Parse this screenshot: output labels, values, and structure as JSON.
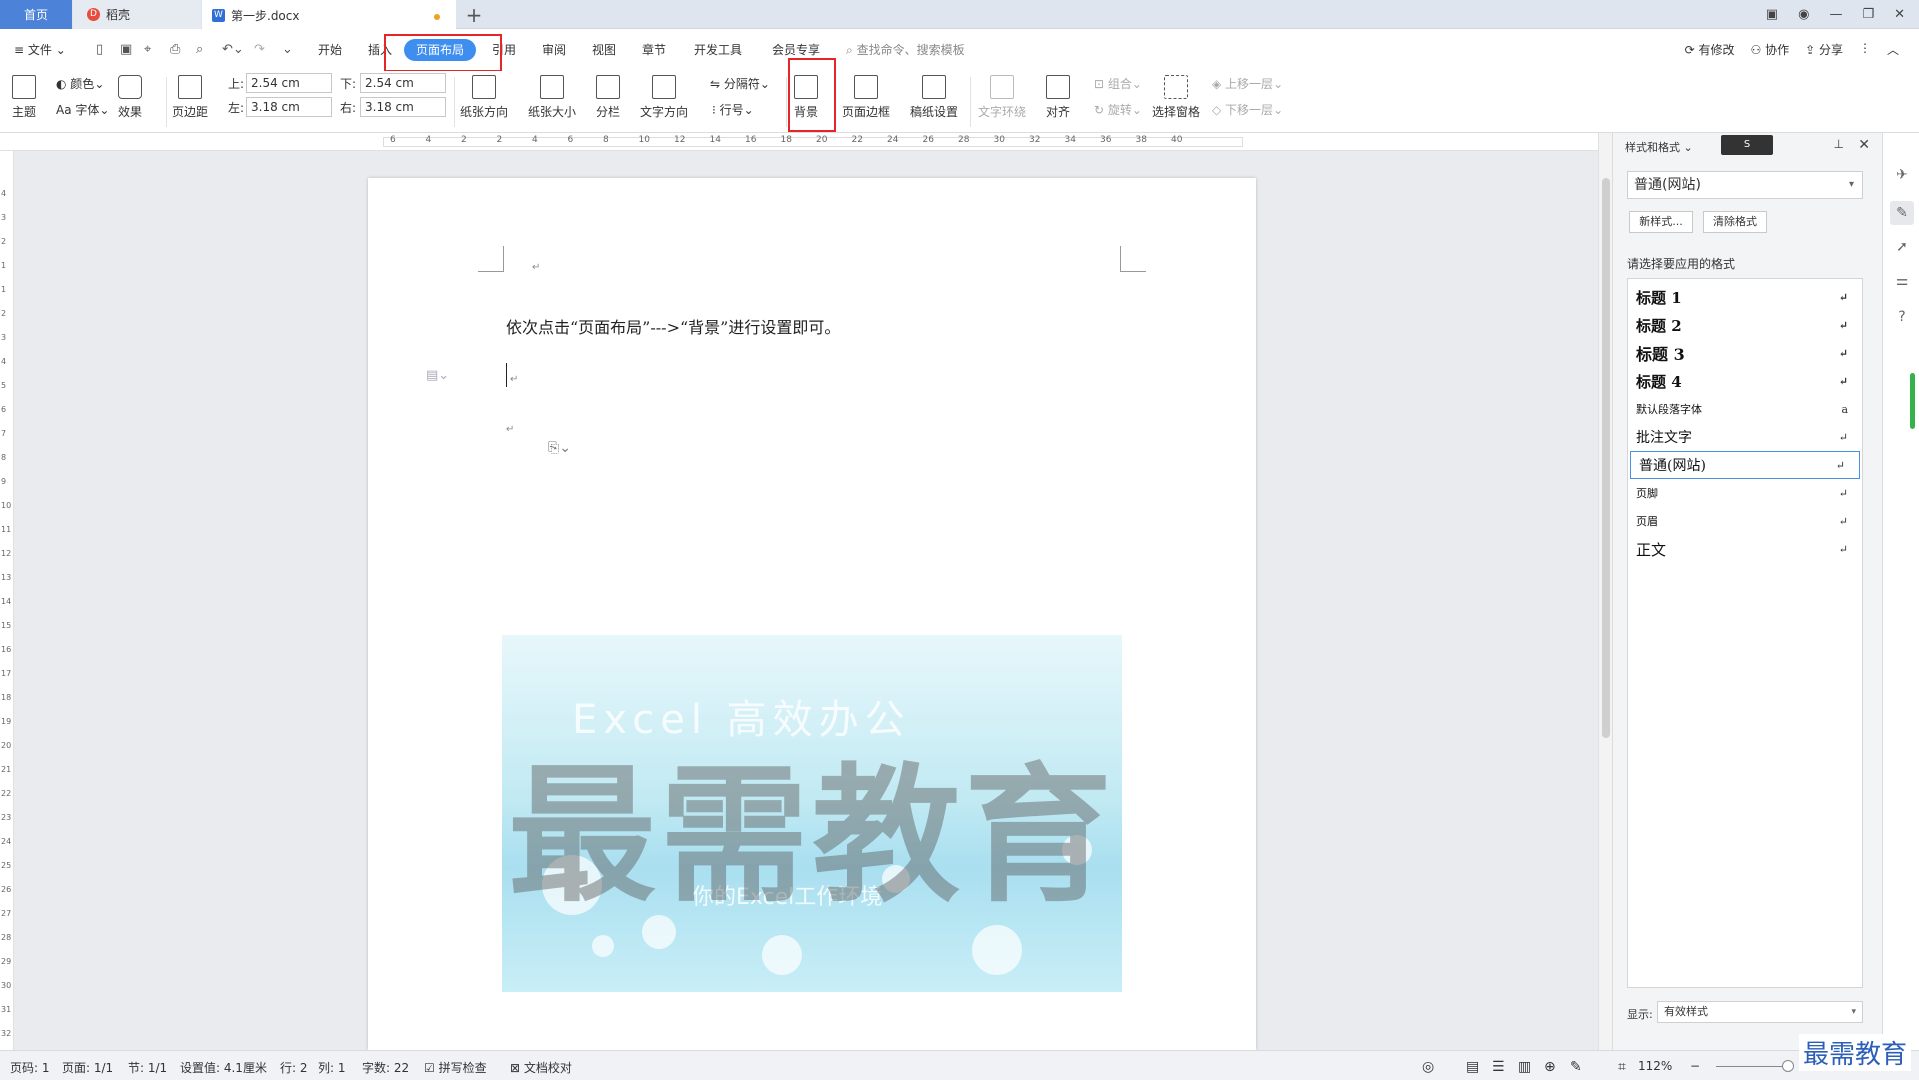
{
  "tabs": {
    "home": "首页",
    "daoke": "稻壳",
    "doc": "第一步.docx",
    "add": "+"
  },
  "menu": {
    "file": "文件",
    "items": [
      "开始",
      "插入",
      "页面布局",
      "引用",
      "审阅",
      "视图",
      "章节",
      "开发工具",
      "会员专享"
    ],
    "search_placeholder": "查找命令、搜索模板",
    "modified": "有修改",
    "collab": "协作",
    "share": "分享"
  },
  "ribbon": {
    "theme": "主题",
    "colors": "颜色",
    "fonts": "字体",
    "effects": "效果",
    "margins": "页边距",
    "top_label": "上:",
    "top_value": "2.54 cm",
    "bottom_label": "下:",
    "bottom_value": "2.54 cm",
    "left_label": "左:",
    "left_value": "3.18 cm",
    "right_label": "右:",
    "right_value": "3.18 cm",
    "orientation": "纸张方向",
    "size": "纸张大小",
    "columns": "分栏",
    "text_direction": "文字方向",
    "breaks": "分隔符",
    "line_numbers": "行号",
    "background": "背景",
    "page_border": "页面边框",
    "manuscript": "稿纸设置",
    "wrap": "文字环绕",
    "align": "对齐",
    "group": "组合",
    "rotate": "旋转",
    "selection_pane": "选择窗格",
    "bring_forward": "上移一层",
    "send_backward": "下移一层"
  },
  "ruler": {
    "h_ticks": [
      "6",
      "4",
      "2",
      "2",
      "4",
      "6",
      "8",
      "10",
      "12",
      "14",
      "16",
      "18",
      "20",
      "22",
      "24",
      "26",
      "28",
      "30",
      "32",
      "34",
      "36",
      "38",
      "40"
    ],
    "v_ticks": [
      "4",
      "3",
      "2",
      "1",
      "1",
      "2",
      "3",
      "4",
      "5",
      "6",
      "7",
      "8",
      "9",
      "10",
      "11",
      "12",
      "13",
      "14",
      "15",
      "16",
      "17",
      "18",
      "19",
      "20",
      "21",
      "22",
      "23",
      "24",
      "25",
      "26",
      "27",
      "28",
      "29",
      "30",
      "31",
      "32"
    ]
  },
  "document": {
    "line1": "依次点击“页面布局”--->“背景”进行设置即可。",
    "bg_line1": "Excel 高效办公",
    "bg_line2": "你的Excel工作环境",
    "watermark": "最需教育"
  },
  "panel": {
    "title": "样式和格式",
    "ime": "S",
    "current_style": "普通(网站)",
    "new_style": "新样式...",
    "clear_format": "清除格式",
    "apply_label": "请选择要应用的格式",
    "styles": [
      "标题 1",
      "标题 2",
      "标题 3",
      "标题 4",
      "默认段落字体",
      "批注文字",
      "普通(网站)",
      "页脚",
      "页眉",
      "正文"
    ],
    "show_label": "显示:",
    "show_value": "有效样式"
  },
  "status": {
    "page": "页码: 1",
    "pages": "页面: 1/1",
    "section": "节: 1/1",
    "setting": "设置值: 4.1厘米",
    "row": "行: 2",
    "col": "列: 1",
    "words": "字数: 22",
    "spell": "拼写检查",
    "proof": "文档校对",
    "zoom": "112%"
  },
  "brand": "最需教育",
  "colors": {
    "accent": "#3e8ef0",
    "highlight": "#e62626",
    "home_tab": "#4c82d8"
  }
}
